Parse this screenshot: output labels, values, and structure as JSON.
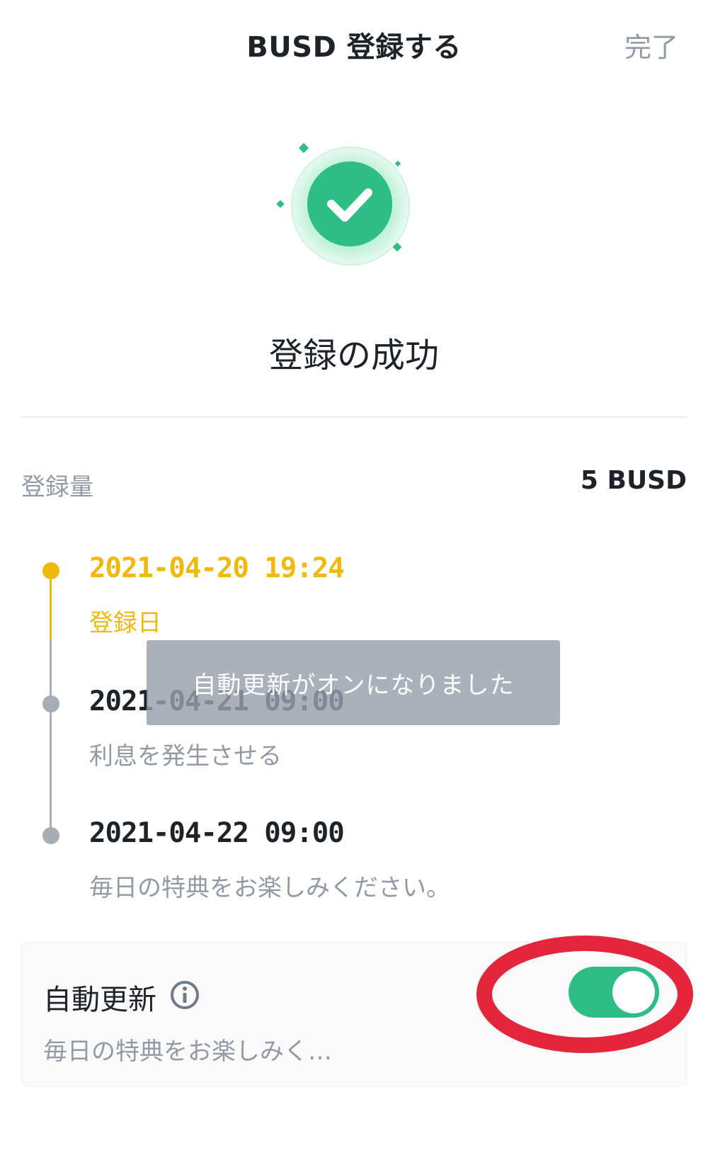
{
  "header": {
    "title": "BUSD 登録する",
    "done_label": "完了"
  },
  "success": {
    "icon": "check-circle-icon",
    "title": "登録の成功"
  },
  "amount": {
    "label": "登録量",
    "value": "5 BUSD"
  },
  "timeline": [
    {
      "date": "2021-04-20 19:24",
      "desc": "登録日",
      "active": true
    },
    {
      "date": "2021-04-21 09:00",
      "desc": "利息を発生させる",
      "active": false
    },
    {
      "date": "2021-04-22 09:00",
      "desc": "毎日の特典をお楽しみください。",
      "active": false
    }
  ],
  "toast": {
    "message": "自動更新がオンになりました"
  },
  "auto_renew": {
    "title": "自動更新",
    "info_icon": "info-icon",
    "desc": "毎日の特典をお楽しみく…",
    "enabled": true
  },
  "colors": {
    "accent_yellow": "#f0b90b",
    "success_green": "#2ebd85",
    "text_primary": "#1e2329",
    "text_secondary": "#929aa5",
    "timeline_gray": "#a7adb5",
    "highlight_red": "#e3263b"
  }
}
